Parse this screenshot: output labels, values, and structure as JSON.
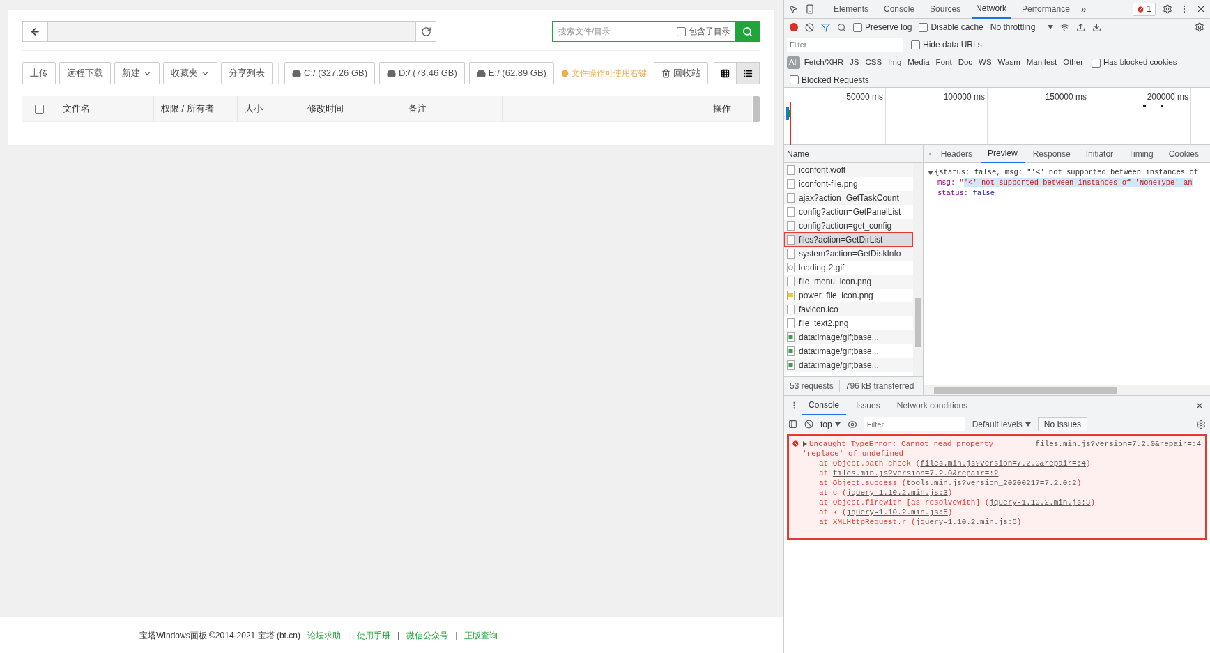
{
  "toolbar": {
    "search_placeholder": "搜索文件/目录",
    "include_subdirs": {
      "label": "包含子目录",
      "checked": false
    }
  },
  "actions": [
    {
      "label": "上传",
      "dropdown": false
    },
    {
      "label": "远程下载",
      "dropdown": false
    },
    {
      "label": "新建",
      "dropdown": true
    },
    {
      "label": "收藏夹",
      "dropdown": true
    },
    {
      "label": "分享列表",
      "dropdown": false
    }
  ],
  "disks": [
    "C:/ (327.26 GB)",
    "D:/ (73.46 GB)",
    "E:/ (62.89 GB)"
  ],
  "hint": "文件操作可使用右键",
  "recycle_bin": "回收站",
  "views": [
    {
      "kind": "grid",
      "selected": false
    },
    {
      "kind": "list",
      "selected": true
    }
  ],
  "table": {
    "select_all": false,
    "columns": [
      "文件名",
      "权限 / 所有者",
      "大小",
      "修改时间",
      "备注",
      "操作"
    ]
  },
  "footer": {
    "copyright": "宝塔Windows面板 ©2014-2021 宝塔 (bt.cn)",
    "separator": "|",
    "links": [
      "论坛求助",
      "使用手册",
      "微信公众号",
      "正版查询"
    ]
  },
  "devtools": {
    "tabs": [
      {
        "label": "Elements",
        "selected": false
      },
      {
        "label": "Console",
        "selected": false
      },
      {
        "label": "Sources",
        "selected": false
      },
      {
        "label": "Network",
        "selected": true
      },
      {
        "label": "Performance",
        "selected": false
      }
    ],
    "more": "»",
    "error_count": "1",
    "preserve_log": {
      "label": "Preserve log",
      "checked": false
    },
    "disable_cache": {
      "label": "Disable cache",
      "checked": false
    },
    "throttling": "No throttling",
    "filter_placeholder": "Filter",
    "hide_data_urls": {
      "label": "Hide data URLs",
      "checked": false
    },
    "types": [
      {
        "label": "All",
        "selected": true
      },
      {
        "label": "Fetch/XHR",
        "selected": false
      },
      {
        "label": "JS",
        "selected": false
      },
      {
        "label": "CSS",
        "selected": false
      },
      {
        "label": "Img",
        "selected": false
      },
      {
        "label": "Media",
        "selected": false
      },
      {
        "label": "Font",
        "selected": false
      },
      {
        "label": "Doc",
        "selected": false
      },
      {
        "label": "WS",
        "selected": false
      },
      {
        "label": "Wasm",
        "selected": false
      },
      {
        "label": "Manifest",
        "selected": false
      },
      {
        "label": "Other",
        "selected": false
      }
    ],
    "has_blocked_cookies": {
      "label": "Has blocked cookies",
      "checked": false
    },
    "blocked_requests": {
      "label": "Blocked Requests",
      "checked": false
    },
    "timeline_labels": [
      "50000 ms",
      "100000 ms",
      "150000 ms",
      "200000 ms"
    ],
    "name_header": "Name",
    "requests": [
      {
        "name": "iconfont.woff",
        "kind": "file",
        "selected": false,
        "annotated": false
      },
      {
        "name": "iconfont-file.png",
        "kind": "file",
        "selected": false,
        "annotated": false
      },
      {
        "name": "ajax?action=GetTaskCount",
        "kind": "file",
        "selected": false,
        "annotated": false
      },
      {
        "name": "config?action=GetPanelList",
        "kind": "file",
        "selected": false,
        "annotated": false
      },
      {
        "name": "config?action=get_config",
        "kind": "file",
        "selected": false,
        "annotated": false
      },
      {
        "name": "files?action=GetDirList",
        "kind": "file",
        "selected": true,
        "annotated": true
      },
      {
        "name": "system?action=GetDiskInfo",
        "kind": "file",
        "selected": false,
        "annotated": false
      },
      {
        "name": "loading-2.gif",
        "kind": "spinner",
        "selected": false,
        "annotated": false
      },
      {
        "name": "file_menu_icon.png",
        "kind": "file",
        "selected": false,
        "annotated": false
      },
      {
        "name": "power_file_icon.png",
        "kind": "folder",
        "selected": false,
        "annotated": false
      },
      {
        "name": "favicon.ico",
        "kind": "file",
        "selected": false,
        "annotated": false
      },
      {
        "name": "file_text2.png",
        "kind": "file",
        "selected": false,
        "annotated": false
      },
      {
        "name": "data:image/gif;base...",
        "kind": "image",
        "selected": false,
        "annotated": false
      },
      {
        "name": "data:image/gif;base...",
        "kind": "image",
        "selected": false,
        "annotated": false
      },
      {
        "name": "data:image/gif;base...",
        "kind": "image",
        "selected": false,
        "annotated": false
      }
    ],
    "summary": [
      "53 requests",
      "796 kB transferred"
    ],
    "detail_tabs": [
      {
        "label": "Headers",
        "selected": false
      },
      {
        "label": "Preview",
        "selected": true
      },
      {
        "label": "Response",
        "selected": false
      },
      {
        "label": "Initiator",
        "selected": false
      },
      {
        "label": "Timing",
        "selected": false
      },
      {
        "label": "Cookies",
        "selected": false
      }
    ],
    "preview": {
      "expanded": true,
      "summary": "{status: false, msg: \"'<' not supported between instances of",
      "fields": [
        {
          "key": "msg",
          "colon": ":",
          "kind": "string",
          "prefix": "\"",
          "value": "'<' not supported between instances of 'NoneType' an",
          "highlighted": true
        },
        {
          "key": "status",
          "colon": ":",
          "kind": "boolean",
          "value": "false",
          "highlighted": false
        }
      ]
    },
    "drawer_tabs": [
      {
        "label": "Console",
        "selected": true
      },
      {
        "label": "Issues",
        "selected": false
      },
      {
        "label": "Network conditions",
        "selected": false
      }
    ],
    "context": "top",
    "console_filter_placeholder": "Filter",
    "levels": "Default levels",
    "issues": "No Issues",
    "error": {
      "annotated": true,
      "expanded": false,
      "message": [
        "Uncaught TypeError: Cannot read property",
        "'replace' of undefined"
      ],
      "source": "files.min.js?version=7.2.0&repair=:4",
      "stack": [
        {
          "before": "at Object.path_check (",
          "link": "files.min.js?version=7.2.0&repair=:4",
          "after": ")"
        },
        {
          "before": "at ",
          "link": "files.min.js?version=7.2.0&repair=:2"
        },
        {
          "before": "at Object.success (",
          "link": "tools.min.js?version_20200217=7.2.0:2",
          "after": ")"
        },
        {
          "before": "at c (",
          "link": "jquery-1.10.2.min.js:3",
          "after": ")"
        },
        {
          "before": "at Object.fireWith [as resolveWith] (",
          "link": "jquery-1.10.2.min.js:3",
          "after": ")"
        },
        {
          "before": "at k (",
          "link": "jquery-1.10.2.min.js:5",
          "after": ")"
        },
        {
          "before": "at XMLHttpRequest.r (",
          "link": "jquery-1.10.2.min.js:5",
          "after": ")"
        }
      ]
    }
  }
}
